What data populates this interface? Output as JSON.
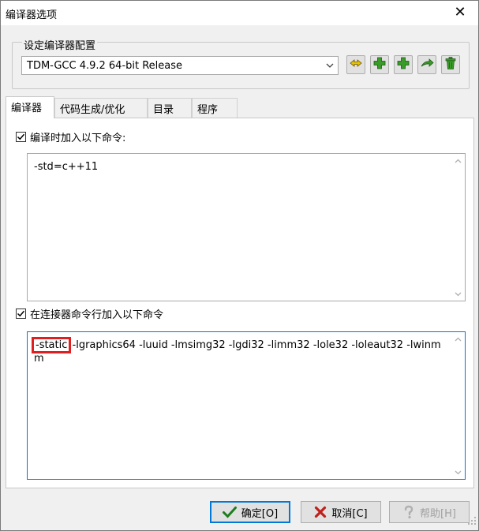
{
  "window": {
    "title": "编译器选项",
    "close_glyph": "✕"
  },
  "config_group": {
    "label": "设定编译器配置",
    "selected": "TDM-GCC 4.9.2 64-bit Release",
    "icons": [
      "rename-icon",
      "add-icon",
      "add-copy-icon",
      "export-icon",
      "delete-icon"
    ]
  },
  "tabs": [
    {
      "label": "编译器"
    },
    {
      "label": "代码生成/优化"
    },
    {
      "label": "目录"
    },
    {
      "label": "程序"
    }
  ],
  "compile_options": {
    "checkbox_label": "编译时加入以下命令:",
    "checked": true,
    "value": "-std=c++11"
  },
  "linker_options": {
    "checkbox_label": "在连接器命令行加入以下命令",
    "checked": true,
    "value_highlighted": "-static",
    "value_rest": " -lgraphics64 -luuid -lmsimg32 -lgdi32 -limm32 -lole32 -loleaut32 -lwinmm"
  },
  "buttons": {
    "ok": "确定[O]",
    "cancel": "取消[C]",
    "help": "帮助[H]"
  },
  "colors": {
    "accent": "#0078d7",
    "highlight_box": "#e02020",
    "ok_check": "#1e7d1e",
    "cancel_x": "#c0201a",
    "tool_green": "#3a9a2a"
  }
}
